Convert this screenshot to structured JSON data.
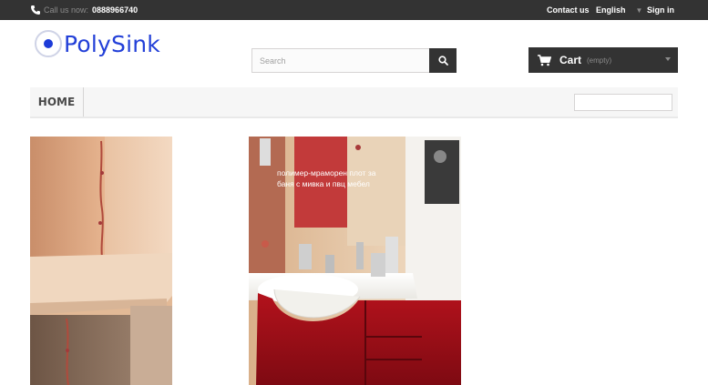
{
  "topbar": {
    "call_label": "Call us now:",
    "phone": "0888966740",
    "contact": "Contact us",
    "language": "English",
    "signin": "Sign in"
  },
  "logo": {
    "text": "PolySink"
  },
  "search": {
    "placeholder": "Search"
  },
  "cart": {
    "label": "Cart",
    "state": "(empty)"
  },
  "menu": {
    "items": [
      "HOME"
    ]
  },
  "products": [
    {
      "caption": ""
    },
    {
      "caption": "полимер-мраморен плот за баня с мивка и пвц мебел"
    }
  ],
  "colors": {
    "topbar": "#333333",
    "brand": "#2340d8",
    "cabinet": "#b3121c"
  }
}
